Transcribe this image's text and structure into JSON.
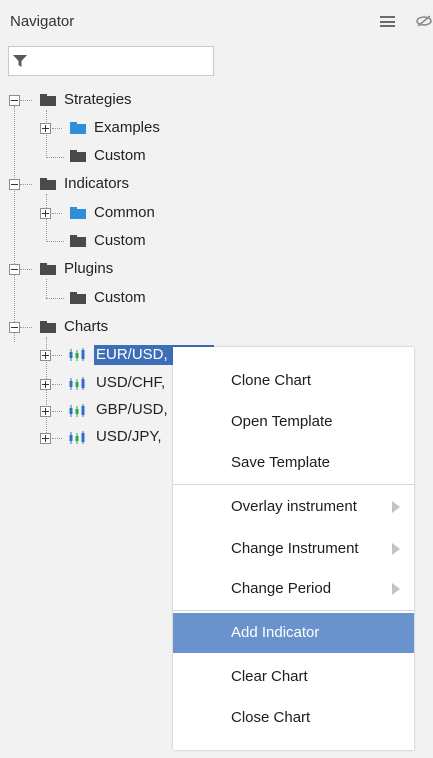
{
  "panel": {
    "title": "Navigator",
    "filter": {
      "value": "",
      "placeholder": ""
    }
  },
  "tree": {
    "strategies": {
      "label": "Strategies",
      "children": [
        "Examples",
        "Custom"
      ]
    },
    "indicators": {
      "label": "Indicators",
      "children": [
        "Common",
        "Custom"
      ]
    },
    "plugins": {
      "label": "Plugins",
      "children": [
        "Custom"
      ]
    },
    "charts": {
      "label": "Charts",
      "children": [
        "EUR/USD, ...",
        "USD/CHF,",
        "GBP/USD,",
        "USD/JPY,"
      ],
      "selected_index": 0
    }
  },
  "context_menu": {
    "items": [
      {
        "label": "Clone Chart",
        "submenu": false
      },
      {
        "label": "Open Template",
        "submenu": false
      },
      {
        "label": "Save Template",
        "submenu": false
      },
      {
        "label": "Overlay instrument",
        "submenu": true
      },
      {
        "label": "Change Instrument",
        "submenu": true
      },
      {
        "label": "Change Period",
        "submenu": true
      },
      {
        "label": "Add Indicator",
        "submenu": false,
        "highlighted": true
      },
      {
        "label": "Clear Chart",
        "submenu": false
      },
      {
        "label": "Close Chart",
        "submenu": false
      }
    ]
  },
  "colors": {
    "selection": "#3d6fb8",
    "menu_highlight": "#6a93cd",
    "folder_dark": "#4a4a4a",
    "folder_blue": "#2e8ed8",
    "candle_blue": "#2e6fc8",
    "candle_green": "#2aa84a"
  },
  "icons": [
    "filter-icon",
    "menu-icon",
    "eye-hide-icon",
    "folder-icon",
    "candlestick-icon",
    "expander-icon",
    "submenu-arrow-icon"
  ]
}
